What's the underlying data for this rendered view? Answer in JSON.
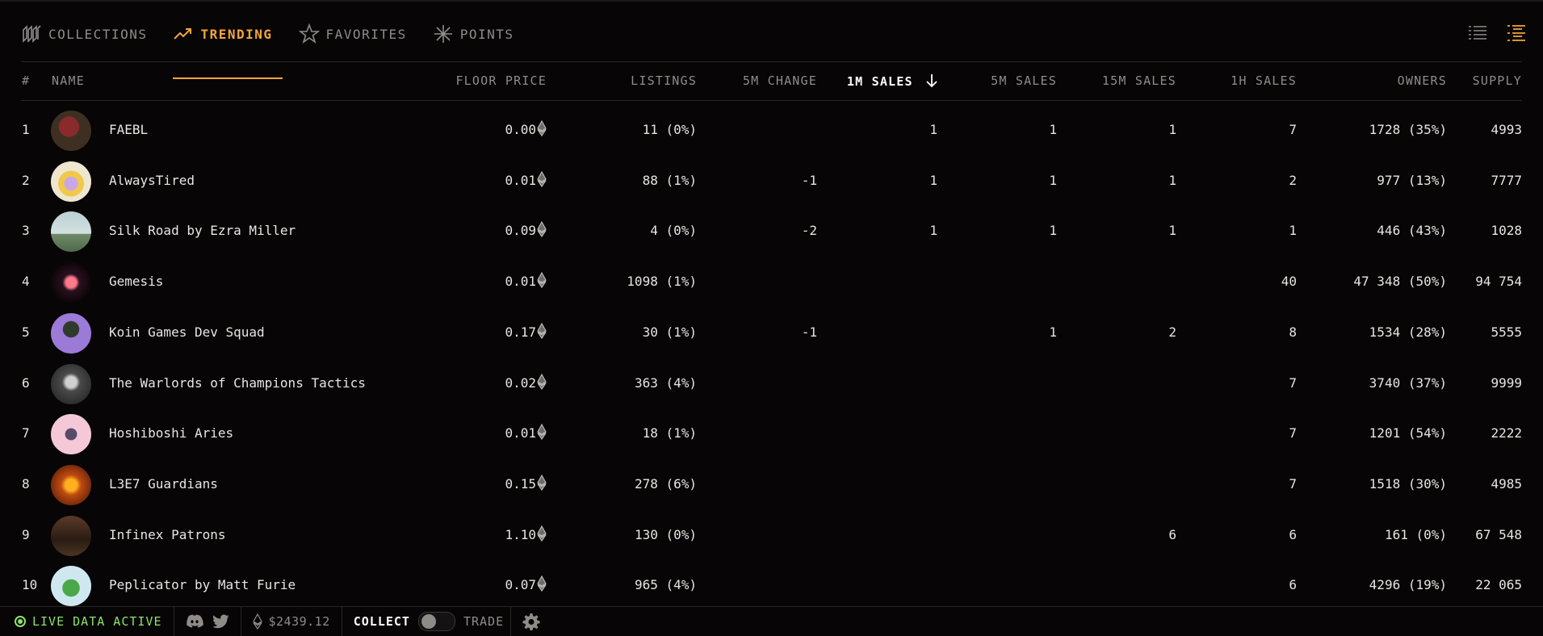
{
  "tabs": [
    {
      "label": "COLLECTIONS",
      "icon": "collections-icon"
    },
    {
      "label": "TRENDING",
      "icon": "trending-icon",
      "active": true
    },
    {
      "label": "FAVORITES",
      "icon": "star-icon"
    },
    {
      "label": "POINTS",
      "icon": "asterisk-icon"
    }
  ],
  "view_icons": [
    "list-view-icon",
    "detailed-list-view-icon"
  ],
  "colors": {
    "accent": "#f3a53a",
    "live": "#8ee26c",
    "background": "#070505"
  },
  "columns": {
    "rank": "#",
    "name": "NAME",
    "floor": "FLOOR PRICE",
    "listings": "LISTINGS",
    "change5m": "5M CHANGE",
    "sales1m": "1M SALES",
    "sales5m": "5M SALES",
    "sales15m": "15M SALES",
    "sales1h": "1H SALES",
    "owners": "OWNERS",
    "supply": "SUPPLY"
  },
  "sorted_column": "sales1m",
  "rows": [
    {
      "rank": "1",
      "name": "FAEBL",
      "floor": "0.00",
      "listings": "11 (0%)",
      "change5m": "",
      "sales1m": "1",
      "sales5m": "1",
      "sales15m": "1",
      "sales1h": "7",
      "owners": "1728 (35%)",
      "supply": "4993"
    },
    {
      "rank": "2",
      "name": "AlwaysTired",
      "floor": "0.01",
      "listings": "88 (1%)",
      "change5m": "-1",
      "sales1m": "1",
      "sales5m": "1",
      "sales15m": "1",
      "sales1h": "2",
      "owners": "977 (13%)",
      "supply": "7777"
    },
    {
      "rank": "3",
      "name": "Silk Road by Ezra Miller",
      "floor": "0.09",
      "listings": "4 (0%)",
      "change5m": "-2",
      "sales1m": "1",
      "sales5m": "1",
      "sales15m": "1",
      "sales1h": "1",
      "owners": "446 (43%)",
      "supply": "1028"
    },
    {
      "rank": "4",
      "name": "Gemesis",
      "floor": "0.01",
      "listings": "1098 (1%)",
      "change5m": "",
      "sales1m": "",
      "sales5m": "",
      "sales15m": "",
      "sales1h": "40",
      "owners": "47 348 (50%)",
      "supply": "94 754"
    },
    {
      "rank": "5",
      "name": "Koin Games Dev Squad",
      "floor": "0.17",
      "listings": "30 (1%)",
      "change5m": "-1",
      "sales1m": "",
      "sales5m": "1",
      "sales15m": "2",
      "sales1h": "8",
      "owners": "1534 (28%)",
      "supply": "5555"
    },
    {
      "rank": "6",
      "name": "The Warlords of Champions Tactics",
      "floor": "0.02",
      "listings": "363 (4%)",
      "change5m": "",
      "sales1m": "",
      "sales5m": "",
      "sales15m": "",
      "sales1h": "7",
      "owners": "3740 (37%)",
      "supply": "9999"
    },
    {
      "rank": "7",
      "name": "Hoshiboshi Aries",
      "floor": "0.01",
      "listings": "18 (1%)",
      "change5m": "",
      "sales1m": "",
      "sales5m": "",
      "sales15m": "",
      "sales1h": "7",
      "owners": "1201 (54%)",
      "supply": "2222"
    },
    {
      "rank": "8",
      "name": "L3E7 Guardians",
      "floor": "0.15",
      "listings": "278 (6%)",
      "change5m": "",
      "sales1m": "",
      "sales5m": "",
      "sales15m": "",
      "sales1h": "7",
      "owners": "1518 (30%)",
      "supply": "4985"
    },
    {
      "rank": "9",
      "name": "Infinex Patrons",
      "floor": "1.10",
      "listings": "130 (0%)",
      "change5m": "",
      "sales1m": "",
      "sales5m": "",
      "sales15m": "6",
      "sales1h": "6",
      "owners": "161 (0%)",
      "supply": "67 548"
    },
    {
      "rank": "10",
      "name": "Peplicator by Matt Furie",
      "floor": "0.07",
      "listings": "965 (4%)",
      "change5m": "",
      "sales1m": "",
      "sales5m": "",
      "sales15m": "",
      "sales1h": "6",
      "owners": "4296 (19%)",
      "supply": "22 065"
    }
  ],
  "footer": {
    "live_label": "LIVE DATA ACTIVE",
    "eth_price": "$2439.12",
    "collect_label": "COLLECT",
    "trade_label": "TRADE",
    "icons": [
      "discord-icon",
      "twitter-icon",
      "eth-icon",
      "settings-icon"
    ]
  }
}
